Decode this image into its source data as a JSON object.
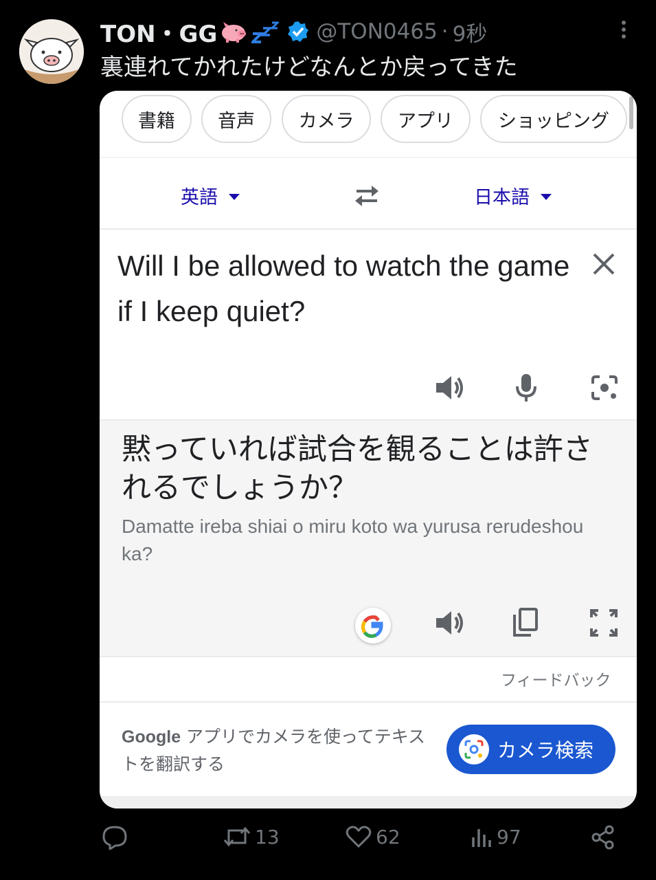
{
  "tweet": {
    "display_name": "TON・GG",
    "handle": "@TON0465",
    "separator": "·",
    "time": "9秒",
    "text": "裏連れてかれたけどなんとか戻ってきた",
    "verified_color": "#1d9bf0"
  },
  "screenshot": {
    "chips": [
      "書籍",
      "音声",
      "カメラ",
      "アプリ",
      "ショッピング"
    ],
    "source_lang": "英語",
    "target_lang": "日本語",
    "source_text": "Will I be allowed to watch the game if I keep quiet?",
    "translation": "黙っていれば試合を観ることは許されるでしょうか？",
    "romanization": "Damatte ireba shiai o miru koto wa yurusa rerudeshou ka?",
    "feedback": "フィードバック",
    "promo_brand": "Google",
    "promo_text": " アプリでカメラを使ってテキストを翻訳する",
    "camera_button": "カメラ検索",
    "link_color": "#1a0dab",
    "button_color": "#1a57d0"
  },
  "actions": {
    "reply_count": "",
    "retweet_count": "13",
    "like_count": "62",
    "views_count": "97"
  }
}
